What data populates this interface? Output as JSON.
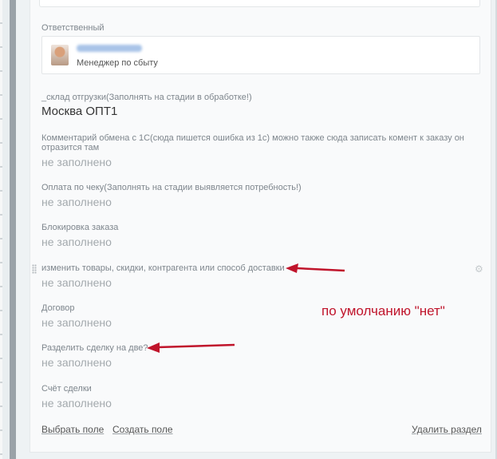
{
  "responsible": {
    "label": "Ответственный",
    "role": "Менеджер по сбыту"
  },
  "fields": [
    {
      "label": "_склад отгрузки(Заполнять на стадии в обработке!)",
      "value": "Москва ОПТ1"
    },
    {
      "label": "Комментарий обмена с 1С(сюда пишется ошибка из 1с) можно также сюда записать комент к заказу он",
      "label2": "отразится там",
      "value": "не заполнено"
    },
    {
      "label": "Оплата по чеку(Заполнять на стадии выявляется потребность!)",
      "value": "не заполнено"
    },
    {
      "label": "Блокировка заказа",
      "value": "не заполнено"
    },
    {
      "label": "изменить товары, скидки, контрагента или способ доставки",
      "value": "не заполнено"
    },
    {
      "label": "Договор",
      "value": "не заполнено"
    },
    {
      "label": "Разделить сделку на две?",
      "value": "не заполнено"
    },
    {
      "label": "Счёт сделки",
      "value": "не заполнено"
    }
  ],
  "actions": {
    "select_field": "Выбрать поле",
    "create_field": "Создать поле",
    "delete_section": "Удалить раздел"
  },
  "annotation": {
    "text": "по умолчанию \"нет\"",
    "color": "#c0142b"
  },
  "icons": [
    "gear-icon",
    "drag-handle-icon",
    "avatar"
  ]
}
